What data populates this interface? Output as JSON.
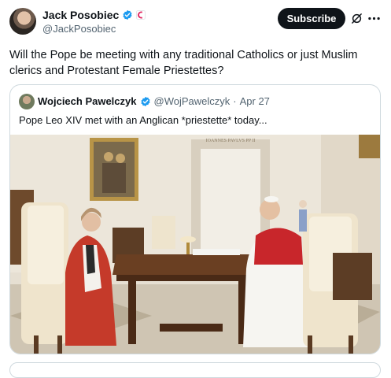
{
  "tweet": {
    "author_name": "Jack Posobiec",
    "author_handle": "@JackPosobiec",
    "subscribe_label": "Subscribe",
    "text": "Will the Pope be meeting with any traditional Catholics or just Muslim clerics and Protestant Female Priestettes?"
  },
  "quote": {
    "author_name": "Wojciech Pawelczyk",
    "author_handle": "@WojPawelczyk",
    "separator": "·",
    "date": "Apr 27",
    "text": "Pope Leo XIV met with an Anglican *priestette* today...",
    "image_inscription": "IOANNES PAVLVS PP II"
  },
  "colors": {
    "accent": "#1d9bf0",
    "text": "#0f1419",
    "muted": "#536471",
    "border": "#cfd9de"
  },
  "icons": [
    "verified-badge-icon",
    "organization-badge-icon",
    "grok-icon",
    "more-icon"
  ]
}
